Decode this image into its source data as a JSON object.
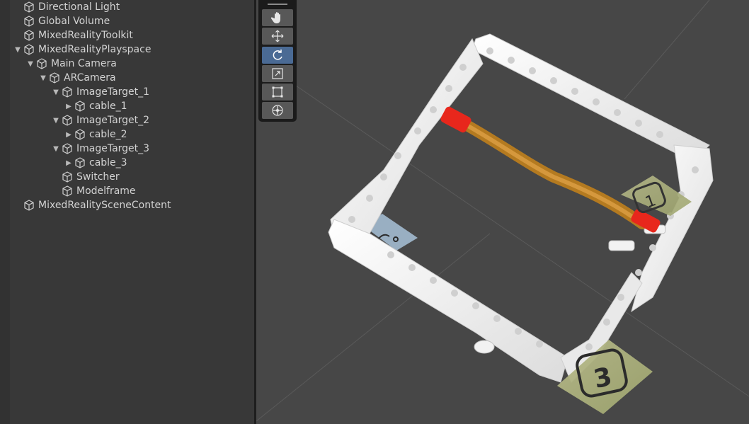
{
  "hierarchy": {
    "items": [
      {
        "label": "Directional Light",
        "depth": 1,
        "expand": "none"
      },
      {
        "label": "Global Volume",
        "depth": 1,
        "expand": "none"
      },
      {
        "label": "MixedRealityToolkit",
        "depth": 1,
        "expand": "none"
      },
      {
        "label": "MixedRealityPlayspace",
        "depth": 1,
        "expand": "expanded"
      },
      {
        "label": "Main Camera",
        "depth": 2,
        "expand": "expanded"
      },
      {
        "label": "ARCamera",
        "depth": 3,
        "expand": "expanded"
      },
      {
        "label": "ImageTarget_1",
        "depth": 4,
        "expand": "expanded"
      },
      {
        "label": "cable_1",
        "depth": 5,
        "expand": "collapsed"
      },
      {
        "label": "ImageTarget_2",
        "depth": 4,
        "expand": "expanded"
      },
      {
        "label": "cable_2",
        "depth": 5,
        "expand": "collapsed"
      },
      {
        "label": "ImageTarget_3",
        "depth": 4,
        "expand": "expanded"
      },
      {
        "label": "cable_3",
        "depth": 5,
        "expand": "collapsed"
      },
      {
        "label": "Switcher",
        "depth": 4,
        "expand": "none"
      },
      {
        "label": "Modelframe",
        "depth": 4,
        "expand": "none"
      },
      {
        "label": "MixedRealitySceneContent",
        "depth": 1,
        "expand": "none"
      }
    ]
  },
  "toolbar": {
    "tools": [
      {
        "name": "hand-tool",
        "icon": "hand-icon",
        "active": false
      },
      {
        "name": "move-tool",
        "icon": "move-arrows-icon",
        "active": false
      },
      {
        "name": "rotate-tool",
        "icon": "rotate-icon",
        "active": true
      },
      {
        "name": "scale-tool",
        "icon": "scale-icon",
        "active": false
      },
      {
        "name": "rect-tool",
        "icon": "rect-transform-icon",
        "active": false
      },
      {
        "name": "transform-tool",
        "icon": "transform-icon",
        "active": false
      }
    ]
  },
  "scene": {
    "markers": [
      {
        "name": "image-target-marker-1",
        "label": "1"
      },
      {
        "name": "image-target-marker-3",
        "label": "3"
      }
    ]
  },
  "colors": {
    "panel_bg": "#383838",
    "scene_bg": "#474747",
    "selection": "#4a6a94",
    "text": "#d2d2d2"
  }
}
